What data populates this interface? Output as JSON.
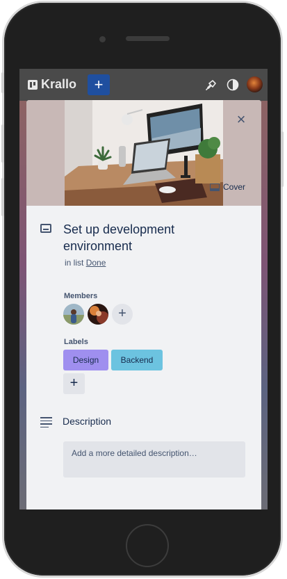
{
  "topbar": {
    "app_name": "Krallo",
    "add_label": "+"
  },
  "modal": {
    "close_label": "×",
    "cover_button": "Cover",
    "card_title": "Set up development environment",
    "in_list_prefix": "in list",
    "list_name": "Done",
    "members_heading": "Members",
    "add_member_label": "+",
    "labels_heading": "Labels",
    "labels": [
      {
        "name": "Design",
        "color": "#9f8fef"
      },
      {
        "name": "Backend",
        "color": "#6cc3e0"
      }
    ],
    "add_label_label": "+",
    "description_heading": "Description",
    "description_placeholder": "Add a more detailed description…"
  },
  "colors": {
    "accent": "#1f4f9f",
    "modal_background": "#f1f2f4",
    "text_primary": "#172b4d"
  }
}
